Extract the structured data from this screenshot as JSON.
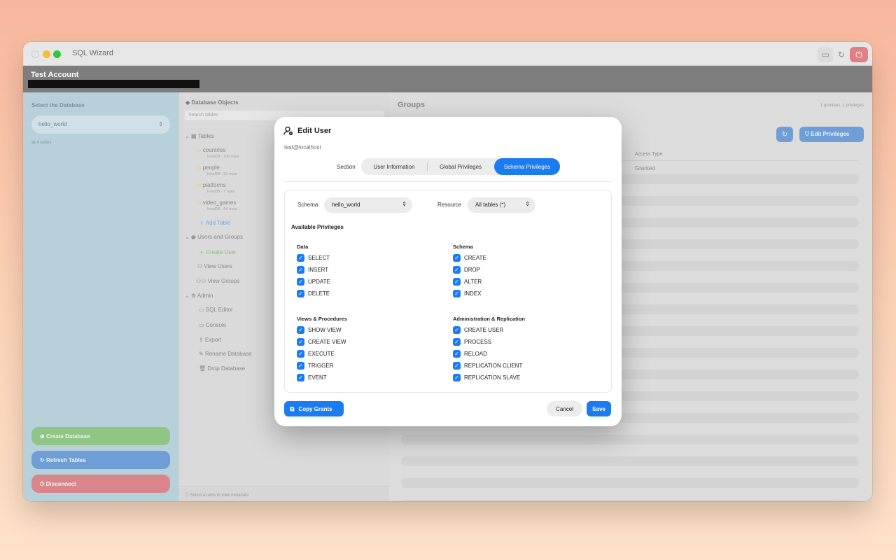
{
  "window": {
    "app_title": "SQL Wizard",
    "account_name": "Test Account"
  },
  "sidebar": {
    "label": "Select the Database",
    "selected_db": "hello_world",
    "tables_count": "4 tables",
    "buttons": {
      "create": "Create Database",
      "refresh": "Refresh Tables",
      "disconnect": "Disconnect"
    }
  },
  "objects": {
    "header": "Database Objects",
    "search_placeholder": "Search tables",
    "tables_section": "Tables",
    "tables": [
      {
        "name": "countries",
        "meta": "InnoDB · 100 rows"
      },
      {
        "name": "people",
        "meta": "InnoDB · 50 rows"
      },
      {
        "name": "platforms",
        "meta": "InnoDB · 7 rows"
      },
      {
        "name": "video_games",
        "meta": "InnoDB · 94 rows"
      }
    ],
    "add_table": "Add Table",
    "users_section": "Users and Groups",
    "create_user": "Create User",
    "view_users": "View Users",
    "view_groups": "View Groups",
    "admin_section": "Admin",
    "admin_items": [
      "SQL Editor",
      "Console",
      "Export",
      "Rename Database",
      "Drop Database"
    ],
    "footer": "Select a table to view metadata"
  },
  "main": {
    "title": "Groups",
    "grantees": "1 grantees, 1 privileges",
    "edit_privileges": "Edit Privileges",
    "col_access_type": "Access Type",
    "granted": "Granted"
  },
  "modal": {
    "title": "Edit User",
    "subtitle": "test@localhost",
    "section_label": "Section",
    "tabs": [
      "User Information",
      "Global Privileges",
      "Schema Privileges"
    ],
    "active_tab": "Schema Privileges",
    "schema_label": "Schema",
    "schema_value": "hello_world",
    "resource_label": "Resource",
    "resource_value": "All tables (*)",
    "available_privileges": "Available Privileges",
    "groups": {
      "data": {
        "title": "Data",
        "items": [
          "SELECT",
          "INSERT",
          "UPDATE",
          "DELETE"
        ]
      },
      "schema": {
        "title": "Schema",
        "items": [
          "CREATE",
          "DROP",
          "ALTER",
          "INDEX"
        ]
      },
      "views": {
        "title": "Views & Procedures",
        "items": [
          "SHOW VIEW",
          "CREATE VIEW",
          "EXECUTE",
          "TRIGGER",
          "EVENT"
        ]
      },
      "admin": {
        "title": "Administration & Replication",
        "items": [
          "CREATE USER",
          "PROCESS",
          "RELOAD",
          "REPLICATION CLIENT",
          "REPLICATION SLAVE"
        ]
      }
    },
    "copy_grants": "Copy Grants",
    "cancel": "Cancel",
    "save": "Save"
  },
  "colors": {
    "accent": "#1a7cf0",
    "create_green": "#8fc585",
    "refresh_blue": "#6f9ed6",
    "disconnect_red": "#d9858b"
  }
}
